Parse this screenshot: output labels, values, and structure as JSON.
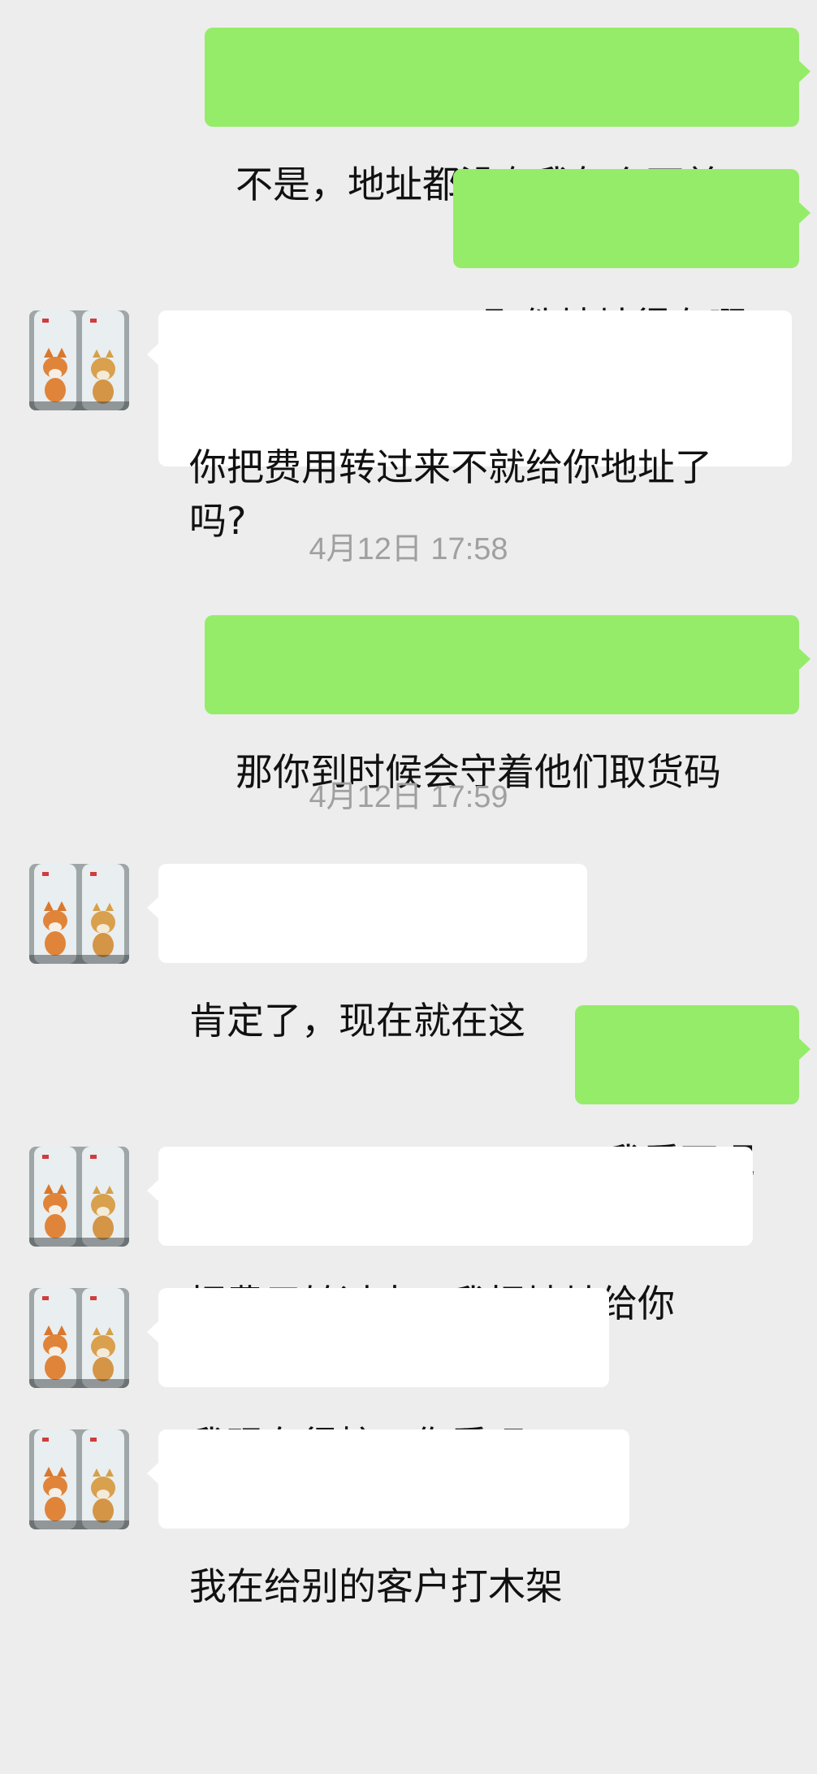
{
  "conversation": {
    "messages": [
      {
        "side": "out",
        "text": "不是，地址都没有我怎么下单"
      },
      {
        "side": "out",
        "text": "取件地址得有啊"
      },
      {
        "side": "in",
        "text": "你把费用转过来不就给你地址了\n吗?"
      },
      {
        "side": "out",
        "text": "那你到时候会守着他们取货码"
      },
      {
        "side": "in",
        "text": "肯定了，现在就在这"
      },
      {
        "side": "out",
        "text": "我看下呢"
      },
      {
        "side": "in",
        "text": "把费用转过来，我把地址给你"
      },
      {
        "side": "in",
        "text": "我现在很忙，你看吧!"
      },
      {
        "side": "in",
        "text": "我在给别的客户打木架"
      }
    ],
    "timestamps": [
      {
        "text": "4月12日 17:58"
      },
      {
        "text": "4月12日 17:59"
      }
    ]
  },
  "colors": {
    "background": "#ededed",
    "outgoing_bubble": "#95ec69",
    "incoming_bubble": "#ffffff",
    "timestamp_text": "#a0a0a0"
  },
  "icons": {
    "avatar": "contact-avatar-fox-tiger-bottles"
  }
}
